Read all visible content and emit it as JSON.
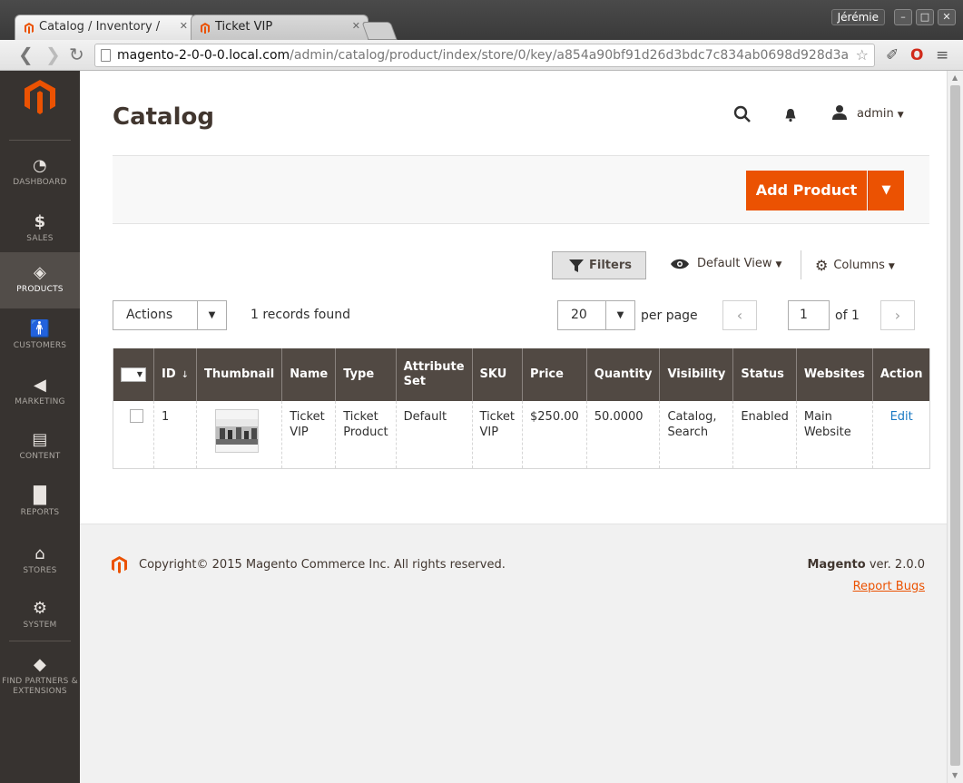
{
  "browser": {
    "tabs": [
      {
        "title": "Catalog / Inventory /"
      },
      {
        "title": "Ticket VIP"
      }
    ],
    "user": "Jérémie",
    "url_host": "magento-2-0-0-0.local.com",
    "url_path": "/admin/catalog/product/index/store/0/key/a854a90bf91d26d3bdc7c834ab0698d928d3a"
  },
  "sidebar": {
    "items": [
      {
        "label": "DASHBOARD",
        "icon": "dashboard-icon"
      },
      {
        "label": "SALES",
        "icon": "dollar-icon"
      },
      {
        "label": "PRODUCTS",
        "icon": "box-icon"
      },
      {
        "label": "CUSTOMERS",
        "icon": "person-icon"
      },
      {
        "label": "MARKETING",
        "icon": "megaphone-icon"
      },
      {
        "label": "CONTENT",
        "icon": "content-icon"
      },
      {
        "label": "REPORTS",
        "icon": "bar-chart-icon"
      },
      {
        "label": "STORES",
        "icon": "store-icon"
      },
      {
        "label": "SYSTEM",
        "icon": "gear-icon"
      },
      {
        "label": "FIND PARTNERS & EXTENSIONS",
        "icon": "puzzle-icon"
      }
    ],
    "active": "PRODUCTS"
  },
  "header": {
    "title": "Catalog",
    "user": "admin"
  },
  "actions": {
    "add_product": "Add Product"
  },
  "grid_controls": {
    "filters": "Filters",
    "view": "Default View",
    "columns": "Columns",
    "mass_action": "Actions",
    "records_found": "1 records found",
    "per_page_value": "20",
    "per_page_label": "per page",
    "page_current": "1",
    "page_of": "of 1"
  },
  "grid": {
    "columns": [
      "ID",
      "Thumbnail",
      "Name",
      "Type",
      "Attribute Set",
      "SKU",
      "Price",
      "Quantity",
      "Visibility",
      "Status",
      "Websites",
      "Action"
    ],
    "rows": [
      {
        "id": "1",
        "name": "Ticket VIP",
        "type": "Ticket Product",
        "attribute_set": "Default",
        "sku": "Ticket VIP",
        "price": "$250.00",
        "quantity": "50.0000",
        "visibility": "Catalog, Search",
        "status": "Enabled",
        "websites": "Main Website",
        "action": "Edit"
      }
    ]
  },
  "footer": {
    "copyright": "Copyright© 2015 Magento Commerce Inc. All rights reserved.",
    "brand": "Magento",
    "version": "ver. 2.0.0",
    "report_bugs": "Report Bugs"
  },
  "colors": {
    "accent": "#eb5202",
    "sidebar": "#373330",
    "grid_header": "#514943",
    "link": "#1979c3"
  }
}
